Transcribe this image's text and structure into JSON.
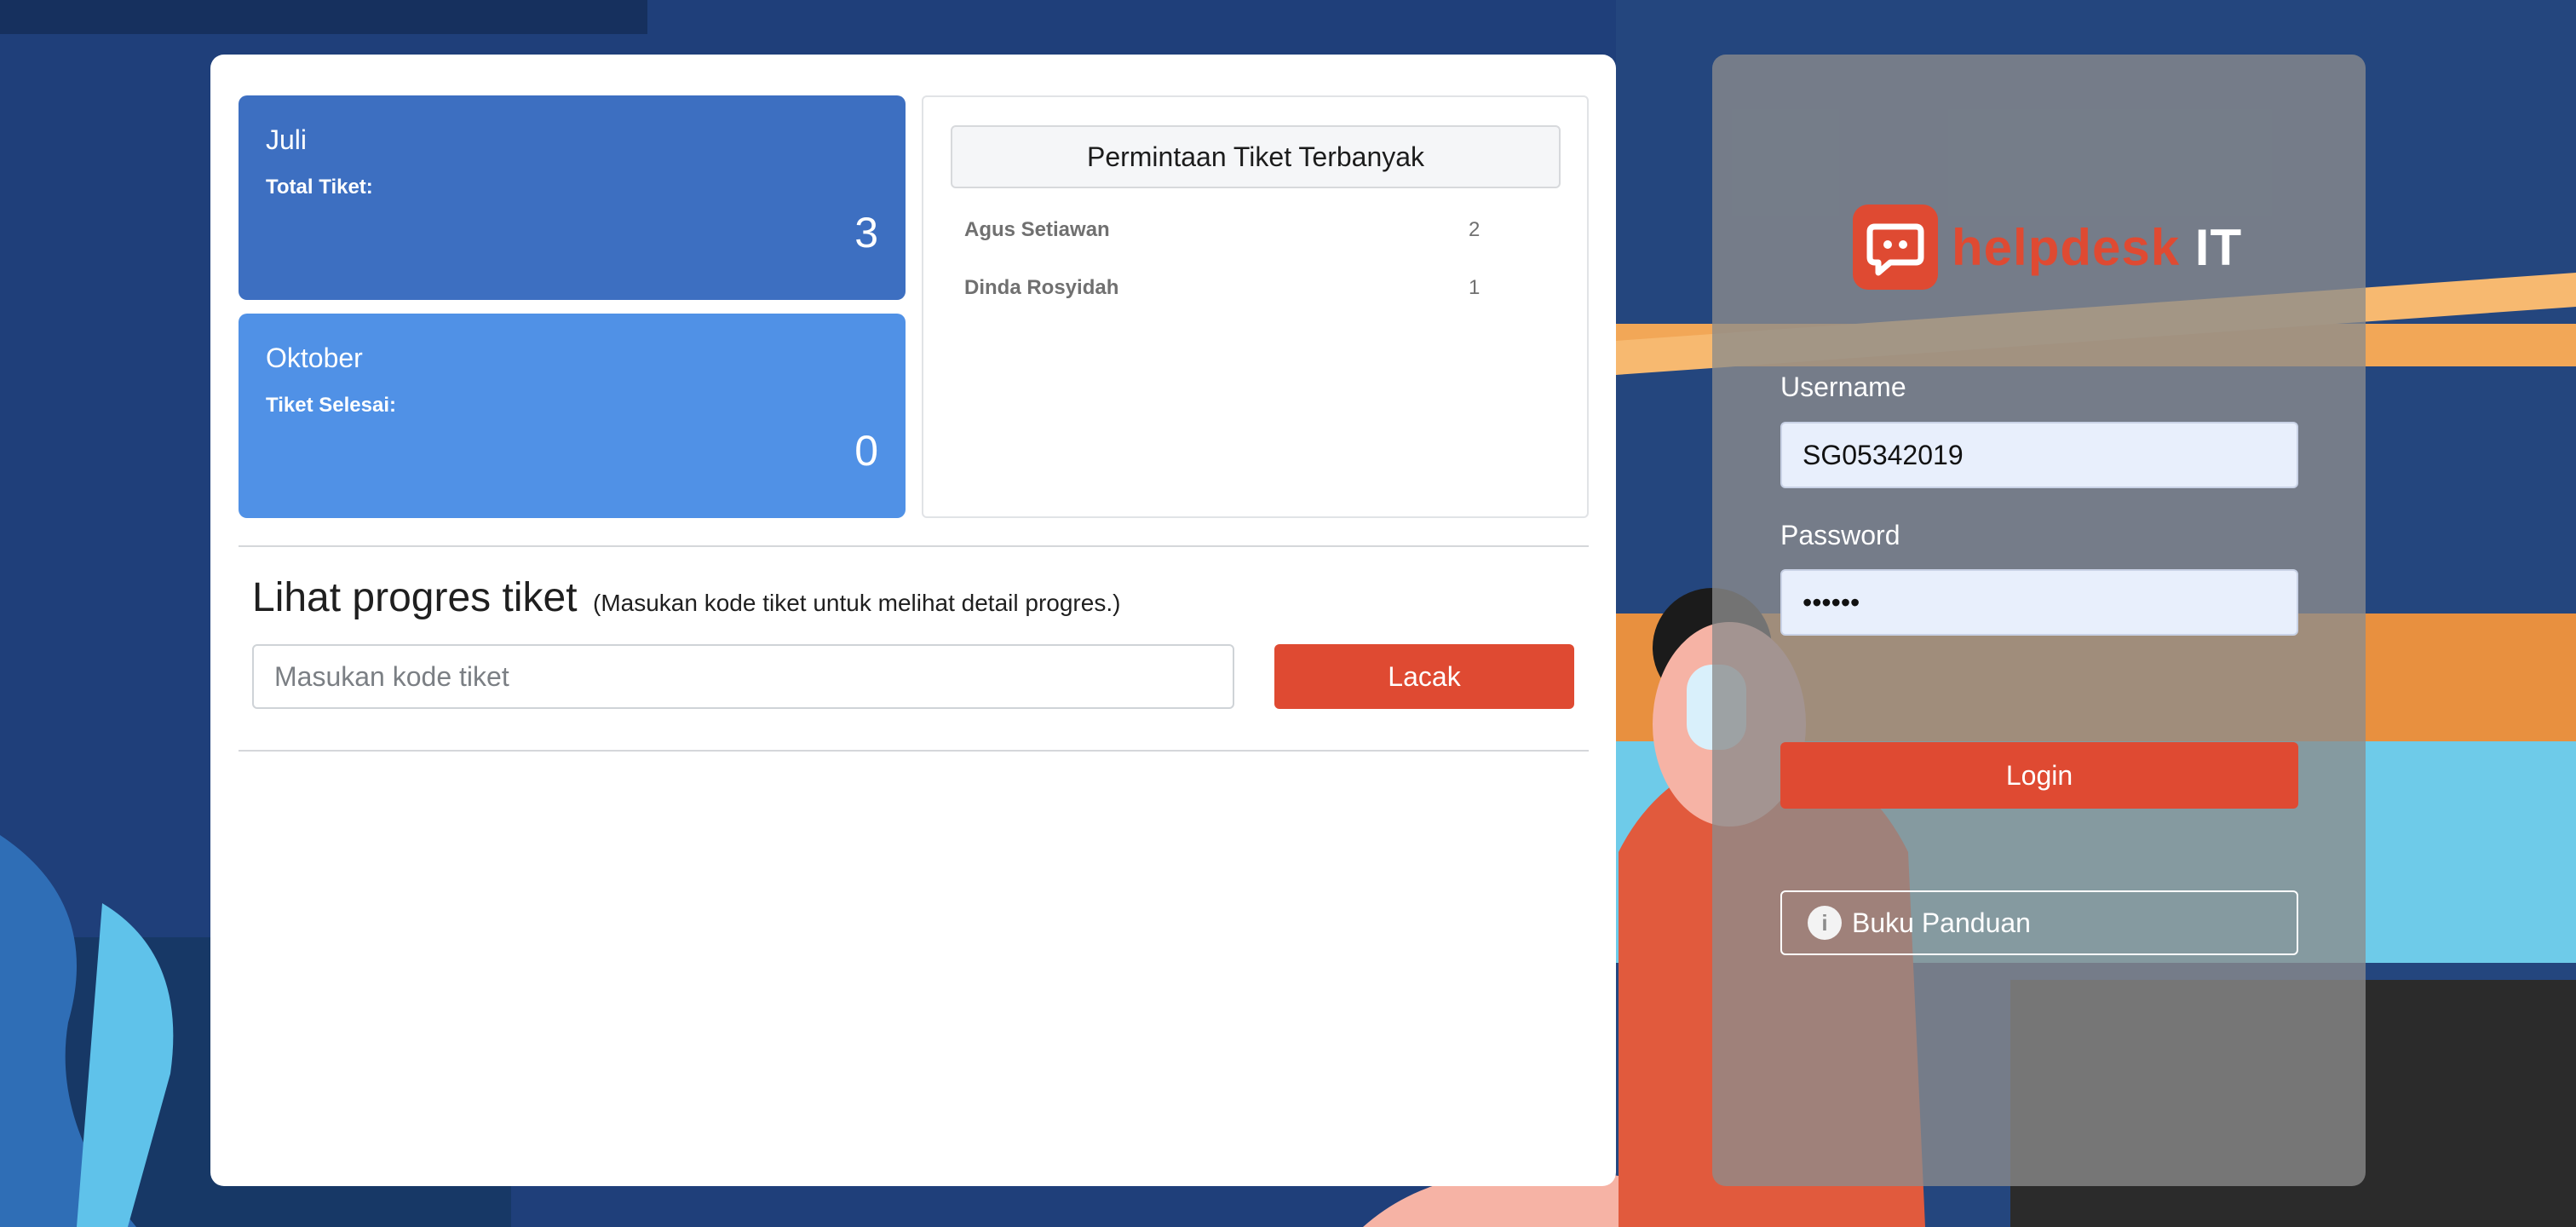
{
  "stats": [
    {
      "month": "Juli",
      "label": "Total Tiket:",
      "value": "3"
    },
    {
      "month": "Oktober",
      "label": "Tiket Selesai:",
      "value": "0"
    }
  ],
  "top_requests": {
    "title": "Permintaan Tiket Terbanyak",
    "rows": [
      {
        "name": "Agus Setiawan",
        "count": "2"
      },
      {
        "name": "Dinda Rosyidah",
        "count": "1"
      }
    ]
  },
  "tracker": {
    "title": "Lihat progres tiket",
    "hint": "(Masukan kode tiket untuk melihat detail progres.)",
    "input_value": "",
    "input_placeholder": "Masukan kode tiket",
    "button_label": "Lacak"
  },
  "login": {
    "logo_brand": "helpdesk",
    "logo_suffix": "IT",
    "username_label": "Username",
    "username_value": "SG05342019",
    "password_label": "Password",
    "password_value": "••••••",
    "login_button": "Login",
    "guide_button": "Buku Panduan"
  },
  "icons": {
    "logo": "chat-bubble-icon",
    "guide": "info-icon"
  },
  "colors": {
    "accent": "#df4a32",
    "stat_primary": "#3d6fc1",
    "stat_secondary": "#5091e6",
    "background": "#1f3f7a"
  }
}
